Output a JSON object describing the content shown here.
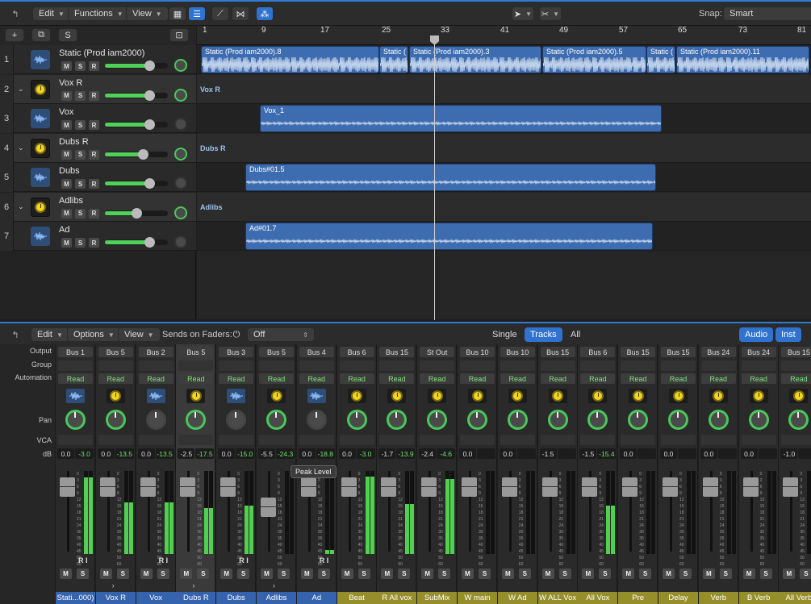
{
  "toolbar": {
    "edit": "Edit",
    "functions": "Functions",
    "view": "View",
    "snap_label": "Snap:",
    "snap_value": "Smart"
  },
  "tracks_header": {
    "s_label": "S"
  },
  "ruler": {
    "bars": [
      "1",
      "9",
      "17",
      "25",
      "33",
      "41",
      "49",
      "57",
      "65",
      "73",
      "81"
    ]
  },
  "tracks": [
    {
      "num": "1",
      "name": "Static (Prod iam2000)",
      "kind": "audio",
      "m": "M",
      "s": "S",
      "r": "R",
      "volume": 0.7,
      "pan_active": true
    },
    {
      "num": "2",
      "name": "Vox R",
      "kind": "folder",
      "m": "M",
      "s": "S",
      "r": "R",
      "volume": 0.7,
      "pan_active": true
    },
    {
      "num": "3",
      "name": "Vox",
      "kind": "audio",
      "m": "M",
      "s": "S",
      "r": "R",
      "volume": 0.7,
      "pan_active": false
    },
    {
      "num": "4",
      "name": "Dubs R",
      "kind": "folder",
      "m": "M",
      "s": "S",
      "r": "R",
      "volume": 0.6,
      "pan_active": true
    },
    {
      "num": "5",
      "name": "Dubs",
      "kind": "audio",
      "m": "M",
      "s": "S",
      "r": "R",
      "volume": 0.7,
      "pan_active": false
    },
    {
      "num": "6",
      "name": "Adlibs",
      "kind": "folder",
      "m": "M",
      "s": "S",
      "r": "R",
      "volume": 0.5,
      "pan_active": true
    },
    {
      "num": "7",
      "name": "Ad",
      "kind": "audio",
      "m": "M",
      "s": "S",
      "r": "R",
      "volume": 0.7,
      "pan_active": false
    }
  ],
  "lanes": {
    "folder_labels": [
      "Vox R",
      "Dubs R",
      "Adlibs"
    ],
    "regions": {
      "static": [
        "Static (Prod iam2000).8",
        "Static (",
        "Static (Prod iam2000).3",
        "Static (Prod iam2000).5",
        "Static (",
        "Static (Prod iam2000).11"
      ],
      "vox": "Vox_1",
      "dubs": "Dubs#01.5",
      "ad": "Ad#01.7"
    }
  },
  "mixer_toolbar": {
    "edit": "Edit",
    "options": "Options",
    "view": "View",
    "sends_label": "Sends on Faders:",
    "sends_value": "Off",
    "single": "Single",
    "tracks": "Tracks",
    "all": "All",
    "audio": "Audio",
    "inst": "Inst"
  },
  "mixer_row_labels": {
    "output": "Output",
    "group": "Group",
    "automation": "Automation",
    "pan": "Pan",
    "vca": "VCA",
    "db": "dB"
  },
  "tooltip": "Peak Level",
  "strips": [
    {
      "output": "Bus 1",
      "auto": "Read",
      "icon": "wave",
      "db1": "0.0",
      "db2": "-3.0",
      "meter": 0.92,
      "name": "Stati...000)",
      "color": "blue",
      "ri": "R I",
      "pan_active": true
    },
    {
      "output": "Bus 5",
      "auto": "Read",
      "icon": "knob",
      "db1": "0.0",
      "db2": "-13.5",
      "meter": 0.62,
      "name": "Vox R",
      "color": "blue",
      "ri": "",
      "pan_active": true
    },
    {
      "output": "Bus 2",
      "auto": "Read",
      "icon": "wave",
      "db1": "0.0",
      "db2": "-13.5",
      "meter": 0.62,
      "name": "Vox",
      "color": "blue",
      "ri": "R I",
      "pan_active": false
    },
    {
      "output": "Bus 5",
      "auto": "Read",
      "icon": "knob",
      "db1": "-2.5",
      "db2": "-17.5",
      "meter": 0.55,
      "name": "Dubs R",
      "color": "blue",
      "ri": "",
      "pan_active": true
    },
    {
      "output": "Bus 3",
      "auto": "Read",
      "icon": "wave",
      "db1": "0.0",
      "db2": "-15.0",
      "meter": 0.58,
      "name": "Dubs",
      "color": "blue",
      "ri": "R I",
      "pan_active": false
    },
    {
      "output": "Bus 5",
      "auto": "Read",
      "icon": "knob",
      "db1": "-5.5",
      "db2": "-24.3",
      "meter": 0.0,
      "name": "Adlibs",
      "color": "blue",
      "ri": "",
      "pan_active": true
    },
    {
      "output": "Bus 4",
      "auto": "Read",
      "icon": "wave",
      "db1": "0.0",
      "db2": "-18.8",
      "meter": 0.05,
      "name": "Ad",
      "color": "blue",
      "ri": "R I",
      "pan_active": false
    },
    {
      "output": "Bus 6",
      "auto": "Read",
      "icon": "knob",
      "db1": "0.0",
      "db2": "-3.0",
      "meter": 0.93,
      "name": "Beat",
      "color": "olive",
      "ri": "",
      "pan_active": true
    },
    {
      "output": "Bus 15",
      "auto": "Read",
      "icon": "knob",
      "db1": "-1.7",
      "db2": "-13.9",
      "meter": 0.6,
      "name": "R All vox",
      "color": "olive",
      "ri": "",
      "pan_active": true
    },
    {
      "output": "St Out",
      "auto": "Read",
      "icon": "knob",
      "db1": "-2.4",
      "db2": "-4.6",
      "meter": 0.9,
      "name": "SubMix",
      "color": "olive",
      "ri": "",
      "pan_active": true
    },
    {
      "output": "Bus 10",
      "auto": "Read",
      "icon": "knob",
      "db1": "0.0",
      "db2": "",
      "meter": 0.0,
      "name": "W main",
      "color": "olive",
      "ri": "",
      "pan_active": true
    },
    {
      "output": "Bus 10",
      "auto": "Read",
      "icon": "knob",
      "db1": "0.0",
      "db2": "",
      "meter": 0.0,
      "name": "W Ad",
      "color": "olive",
      "ri": "",
      "pan_active": true
    },
    {
      "output": "Bus 15",
      "auto": "Read",
      "icon": "knob",
      "db1": "-1.5",
      "db2": "",
      "meter": 0.0,
      "name": "W ALL Vox",
      "color": "olive",
      "ri": "",
      "pan_active": true
    },
    {
      "output": "Bus 6",
      "auto": "Read",
      "icon": "knob",
      "db1": "-1.5",
      "db2": "-15.4",
      "meter": 0.58,
      "name": "All Vox",
      "color": "olive",
      "ri": "",
      "pan_active": true
    },
    {
      "output": "Bus 15",
      "auto": "Read",
      "icon": "knob",
      "db1": "0.0",
      "db2": "",
      "meter": 0.0,
      "name": "Pre",
      "color": "olive",
      "ri": "",
      "pan_active": true
    },
    {
      "output": "Bus 15",
      "auto": "Read",
      "icon": "knob",
      "db1": "0.0",
      "db2": "",
      "meter": 0.0,
      "name": "Delay",
      "color": "olive",
      "ri": "",
      "pan_active": true
    },
    {
      "output": "Bus 24",
      "auto": "Read",
      "icon": "knob",
      "db1": "0.0",
      "db2": "",
      "meter": 0.0,
      "name": "Verb",
      "color": "olive",
      "ri": "",
      "pan_active": true
    },
    {
      "output": "Bus 24",
      "auto": "Read",
      "icon": "knob",
      "db1": "0.0",
      "db2": "",
      "meter": 0.0,
      "name": "B Verb",
      "color": "olive",
      "ri": "",
      "pan_active": true
    },
    {
      "output": "Bus 15",
      "auto": "Read",
      "icon": "knob",
      "db1": "-1.0",
      "db2": "",
      "meter": 0.0,
      "name": "All Verb",
      "color": "olive",
      "ri": "",
      "pan_active": true
    }
  ]
}
